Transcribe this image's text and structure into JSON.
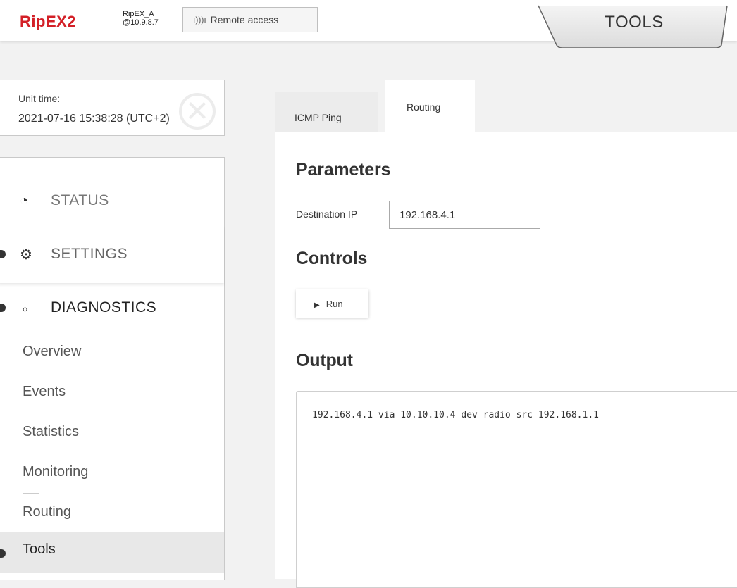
{
  "header": {
    "logo": "RipEX2",
    "unit_name": "RipEX_A",
    "unit_ip": "@10.9.8.7",
    "remote_access_label": "Remote access",
    "remote_access_icon": "antenna-icon",
    "section_title": "TOOLS"
  },
  "unit_time": {
    "label": "Unit time:",
    "value": "2021-07-16 15:38:28 (UTC+2)"
  },
  "sidebar": {
    "status": {
      "label": "STATUS",
      "icon": "gauge-icon"
    },
    "settings": {
      "label": "SETTINGS",
      "icon": "gears-icon"
    },
    "diagnostics": {
      "label": "DIAGNOSTICS",
      "icon": "stethoscope-icon"
    },
    "sub_items": [
      {
        "label": "Overview"
      },
      {
        "label": "Events"
      },
      {
        "label": "Statistics"
      },
      {
        "label": "Monitoring"
      },
      {
        "label": "Routing"
      },
      {
        "label": "Tools"
      }
    ]
  },
  "tabs": [
    {
      "label": "ICMP Ping"
    },
    {
      "label": "Routing"
    }
  ],
  "parameters": {
    "heading": "Parameters",
    "destination_label": "Destination IP",
    "destination_value": "192.168.4.1"
  },
  "controls": {
    "heading": "Controls",
    "run_label": "Run"
  },
  "output": {
    "heading": "Output",
    "text": "192.168.4.1 via 10.10.10.4 dev radio src 192.168.1.1"
  },
  "colors": {
    "brand_red": "#d32027",
    "active_item_bg": "#e8e8e8"
  }
}
